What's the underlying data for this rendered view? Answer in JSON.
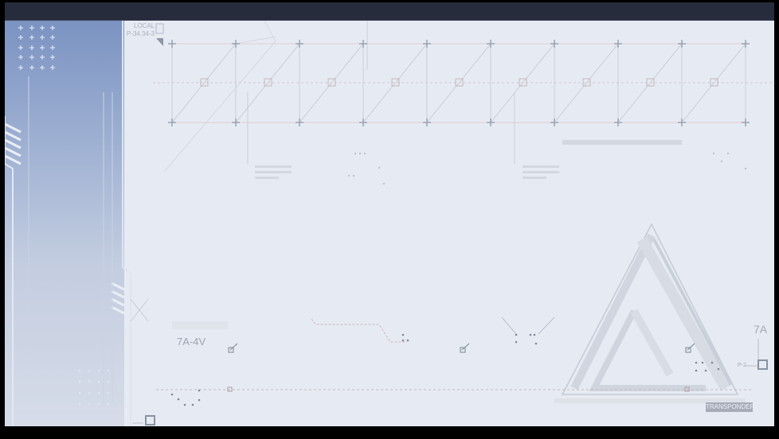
{
  "labels": {
    "local": "LOCAL",
    "code": "P-34.34-3",
    "zone": "7A-4V",
    "sector": "7A",
    "marker": "P-2",
    "transponder": "TRANSPONDER"
  },
  "colors": {
    "titlebar": "#262c3b",
    "screen": "#e6ebf3",
    "panel_top": "#7b93c2",
    "panel_bottom": "#d6dce8",
    "line": "#b9c0cc"
  }
}
